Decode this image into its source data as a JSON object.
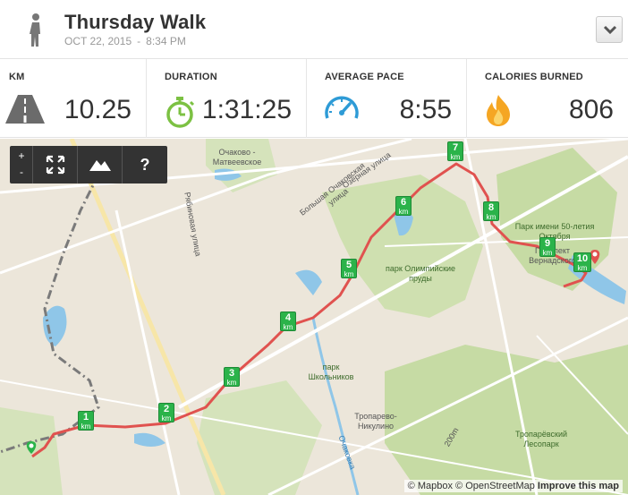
{
  "workout": {
    "title": "Thursday Walk",
    "date": "OCT 22, 2015",
    "separator": "-",
    "time": "8:34 PM",
    "activity_icon": "walking-person-icon"
  },
  "stats": [
    {
      "label": "KM",
      "value": "10.25",
      "icon": "road-icon"
    },
    {
      "label": "DURATION",
      "value": "1:31:25",
      "icon": "stopwatch-icon"
    },
    {
      "label": "AVERAGE PACE",
      "value": "8:55",
      "icon": "speedometer-icon"
    },
    {
      "label": "CALORIES BURNED",
      "value": "806",
      "icon": "flame-icon"
    }
  ],
  "colors": {
    "route": "#e0524f",
    "marker": "#2bb34a",
    "duration_icon": "#7cc143",
    "pace_icon": "#2e9bd6",
    "calorie_icon": "#f5a623"
  },
  "map_controls": {
    "zoom_in": "+",
    "zoom_out": "-",
    "fullscreen_icon": "fullscreen-icon",
    "terrain_icon": "mountain-icon",
    "help": "?"
  },
  "km_markers": [
    {
      "n": "1",
      "unit": "km"
    },
    {
      "n": "2",
      "unit": "km"
    },
    {
      "n": "3",
      "unit": "km"
    },
    {
      "n": "4",
      "unit": "km"
    },
    {
      "n": "5",
      "unit": "km"
    },
    {
      "n": "6",
      "unit": "km"
    },
    {
      "n": "7",
      "unit": "km"
    },
    {
      "n": "8",
      "unit": "km"
    },
    {
      "n": "9",
      "unit": "km"
    },
    {
      "n": "10",
      "unit": "km"
    }
  ],
  "map_labels": {
    "ochakovo": "Очаково - Матвеевское",
    "ochakovskaya": "Большая Очаковская улица",
    "ozernaya": "Озёрная улица",
    "ryabinovaya": "Рябиновая улица",
    "olympic_park": "парк Олимпийские пруды",
    "school_park": "парк Школьников",
    "park50": "Парк имени 50-летия Октября",
    "vernadskogo": "Проспект Вернадского",
    "troparevo": "Тропарево-Никулино",
    "ochakovka": "Очаковка",
    "forest_park": "Тропарёвский Лесопарк",
    "elev": "200m"
  },
  "attribution": {
    "mapbox": "© Mapbox",
    "osm": "© OpenStreetMap",
    "improve": "Improve this map"
  }
}
